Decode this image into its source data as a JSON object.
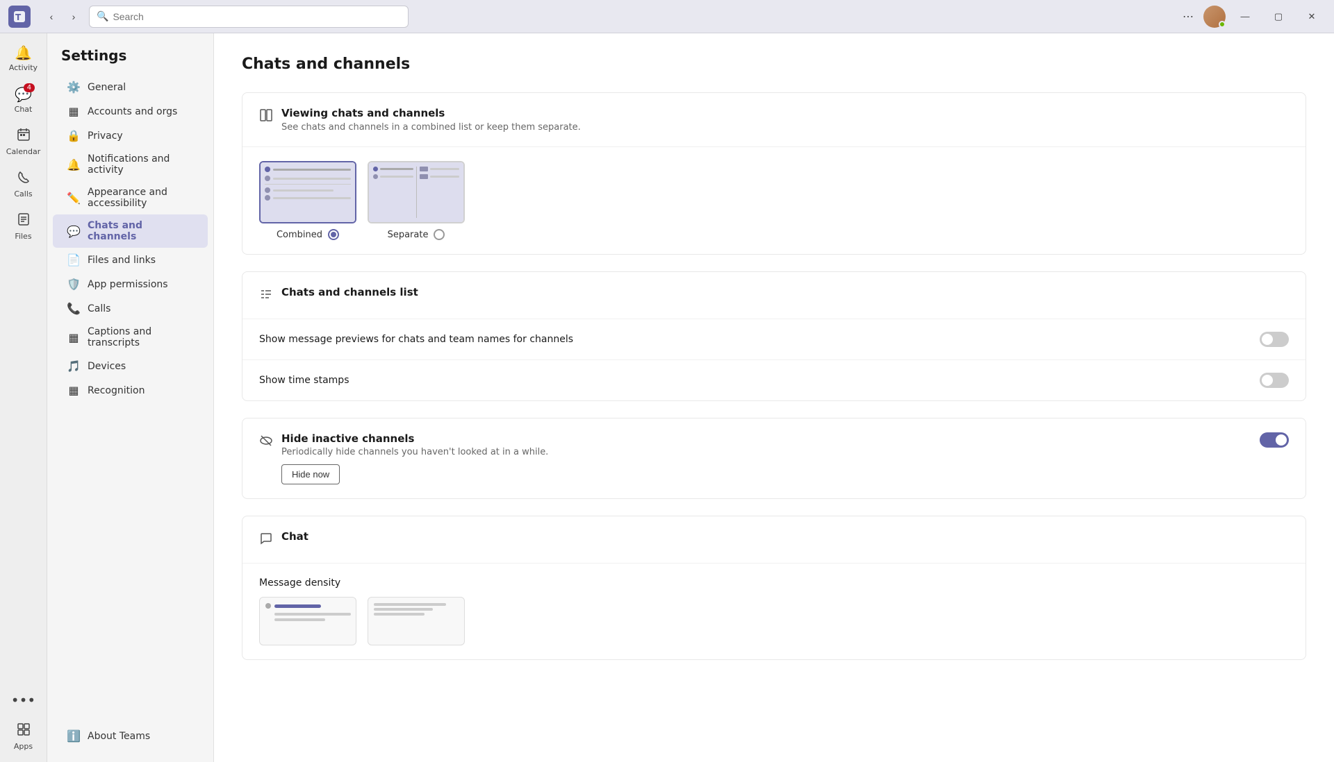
{
  "titlebar": {
    "logo": "T",
    "search_placeholder": "Search",
    "ellipsis": "⋯",
    "minimize": "—",
    "maximize": "▢",
    "close": "✕"
  },
  "left_rail": {
    "items": [
      {
        "id": "activity",
        "label": "Activity",
        "icon": "🔔",
        "badge": null
      },
      {
        "id": "chat",
        "label": "Chat",
        "icon": "💬",
        "badge": "4"
      },
      {
        "id": "calendar",
        "label": "Calendar",
        "icon": "📅",
        "badge": null
      },
      {
        "id": "calls",
        "label": "Calls",
        "icon": "📞",
        "badge": null
      },
      {
        "id": "files",
        "label": "Files",
        "icon": "📄",
        "badge": null
      }
    ],
    "more": "•••",
    "apps_label": "Apps",
    "apps_icon": "⊞"
  },
  "settings": {
    "title": "Settings",
    "nav_items": [
      {
        "id": "general",
        "label": "General",
        "icon": "⚙️"
      },
      {
        "id": "accounts",
        "label": "Accounts and orgs",
        "icon": "▦"
      },
      {
        "id": "privacy",
        "label": "Privacy",
        "icon": "🔒"
      },
      {
        "id": "notifications",
        "label": "Notifications and activity",
        "icon": "🔔"
      },
      {
        "id": "appearance",
        "label": "Appearance and accessibility",
        "icon": "✏️"
      },
      {
        "id": "chats",
        "label": "Chats and channels",
        "icon": "💬",
        "active": true
      },
      {
        "id": "files",
        "label": "Files and links",
        "icon": "📄"
      },
      {
        "id": "app_permissions",
        "label": "App permissions",
        "icon": "🛡️"
      },
      {
        "id": "calls",
        "label": "Calls",
        "icon": "📞"
      },
      {
        "id": "captions",
        "label": "Captions and transcripts",
        "icon": "▦"
      },
      {
        "id": "devices",
        "label": "Devices",
        "icon": "🎵"
      },
      {
        "id": "recognition",
        "label": "Recognition",
        "icon": "▦"
      }
    ],
    "about_label": "About Teams",
    "about_icon": "ℹ️"
  },
  "main": {
    "page_title": "Chats and channels",
    "viewing_section": {
      "title": "Viewing chats and channels",
      "description": "See chats and channels in a combined list or keep them separate.",
      "combined_label": "Combined",
      "separate_label": "Separate",
      "combined_selected": true
    },
    "list_section": {
      "title": "Chats and channels list",
      "toggle_previews_label": "Show message previews for chats and team names for channels",
      "toggle_previews_on": false,
      "toggle_timestamps_label": "Show time stamps",
      "toggle_timestamps_on": false
    },
    "hide_channels_section": {
      "title": "Hide inactive channels",
      "description": "Periodically hide channels you haven't looked at in a while.",
      "toggle_on": true,
      "hide_now_label": "Hide now"
    },
    "chat_section": {
      "title": "Chat",
      "density_label": "Message density"
    }
  }
}
